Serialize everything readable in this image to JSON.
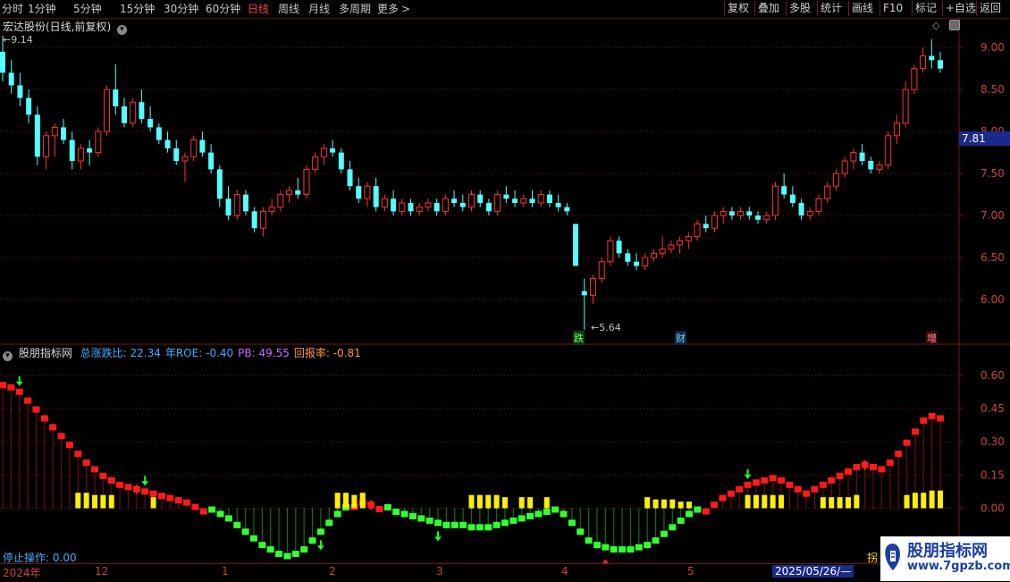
{
  "toolbar": {
    "periods": [
      "分时",
      "1分钟",
      "5分钟",
      "15分钟",
      "30分钟",
      "60分钟",
      "日线",
      "周线",
      "月线",
      "多周期",
      "更多"
    ],
    "active_period": "日线",
    "more_arrow": ">",
    "buttons": [
      "复权",
      "叠加",
      "多股",
      "统计",
      "画线",
      "F10",
      "+自选",
      "返回"
    ],
    "buttons_highlight": "标记"
  },
  "main_panel": {
    "title": "宏达股份(日线,前复权)",
    "high_label": "9.14",
    "low_label": "5.64",
    "current_price_tag": "7.81",
    "price_axis": [
      "9.00",
      "8.50",
      "8.00",
      "7.50",
      "7.00",
      "6.50",
      "6.00"
    ],
    "markers": [
      "跌",
      "财",
      "增"
    ]
  },
  "indicator_panel": {
    "name": "股朋指标网",
    "stats": [
      {
        "label": "总涨跌比:",
        "value": "22.34",
        "color": "#3ab0ff"
      },
      {
        "label": "年ROE:",
        "value": "-0.40",
        "color": "#3ab0ff"
      },
      {
        "label": "PB:",
        "value": "49.55",
        "color": "#c070ff"
      },
      {
        "label": "回报率:",
        "value": "-0.81",
        "color": "#ff9a30"
      }
    ],
    "axis": [
      "0.60",
      "0.45",
      "0.30",
      "0.15",
      "0.00"
    ],
    "stop_label": "停止操作:",
    "stop_value": "0.00"
  },
  "date_bar": {
    "labels": [
      "2024年",
      "12",
      "1",
      "2",
      "3",
      "4",
      "5"
    ],
    "selected_date": "2025/05/26/—",
    "right_text": "拐"
  },
  "watermark": {
    "line1": "股朋指标网",
    "line2": "www.7gpzb.com"
  },
  "colors": {
    "up": "#ff3333",
    "down": "#54ffff",
    "grid": "#7a1515",
    "indicator_up": "#ff1a1a",
    "indicator_down": "#33ff33",
    "bar_yellow": "#ffee00"
  },
  "chart_data": {
    "type": "candlestick",
    "price_range": [
      5.5,
      9.3
    ],
    "candles": [
      {
        "o": 8.95,
        "h": 9.14,
        "l": 8.6,
        "c": 8.7
      },
      {
        "o": 8.7,
        "h": 8.85,
        "l": 8.45,
        "c": 8.55
      },
      {
        "o": 8.55,
        "h": 8.7,
        "l": 8.3,
        "c": 8.4
      },
      {
        "o": 8.4,
        "h": 8.5,
        "l": 8.1,
        "c": 8.2
      },
      {
        "o": 8.2,
        "h": 8.3,
        "l": 7.6,
        "c": 7.7
      },
      {
        "o": 7.7,
        "h": 8.0,
        "l": 7.55,
        "c": 7.95
      },
      {
        "o": 7.95,
        "h": 8.1,
        "l": 7.7,
        "c": 8.05
      },
      {
        "o": 8.05,
        "h": 8.15,
        "l": 7.85,
        "c": 7.9
      },
      {
        "o": 7.9,
        "h": 8.0,
        "l": 7.55,
        "c": 7.65
      },
      {
        "o": 7.65,
        "h": 7.85,
        "l": 7.55,
        "c": 7.8
      },
      {
        "o": 7.8,
        "h": 7.9,
        "l": 7.6,
        "c": 7.75
      },
      {
        "o": 7.75,
        "h": 8.05,
        "l": 7.7,
        "c": 8.0
      },
      {
        "o": 8.0,
        "h": 8.55,
        "l": 7.95,
        "c": 8.5
      },
      {
        "o": 8.5,
        "h": 8.8,
        "l": 8.2,
        "c": 8.3
      },
      {
        "o": 8.3,
        "h": 8.4,
        "l": 8.05,
        "c": 8.1
      },
      {
        "o": 8.1,
        "h": 8.4,
        "l": 8.05,
        "c": 8.35
      },
      {
        "o": 8.35,
        "h": 8.5,
        "l": 8.1,
        "c": 8.15
      },
      {
        "o": 8.15,
        "h": 8.3,
        "l": 8.0,
        "c": 8.05
      },
      {
        "o": 8.05,
        "h": 8.1,
        "l": 7.85,
        "c": 7.9
      },
      {
        "o": 7.9,
        "h": 8.0,
        "l": 7.75,
        "c": 7.8
      },
      {
        "o": 7.8,
        "h": 7.9,
        "l": 7.6,
        "c": 7.65
      },
      {
        "o": 7.65,
        "h": 7.75,
        "l": 7.4,
        "c": 7.7
      },
      {
        "o": 7.7,
        "h": 7.95,
        "l": 7.65,
        "c": 7.9
      },
      {
        "o": 7.9,
        "h": 8.0,
        "l": 7.7,
        "c": 7.75
      },
      {
        "o": 7.75,
        "h": 7.85,
        "l": 7.5,
        "c": 7.55
      },
      {
        "o": 7.55,
        "h": 7.6,
        "l": 7.1,
        "c": 7.2
      },
      {
        "o": 7.2,
        "h": 7.35,
        "l": 6.95,
        "c": 7.0
      },
      {
        "o": 7.0,
        "h": 7.3,
        "l": 6.95,
        "c": 7.25
      },
      {
        "o": 7.25,
        "h": 7.3,
        "l": 7.0,
        "c": 7.05
      },
      {
        "o": 7.05,
        "h": 7.1,
        "l": 6.8,
        "c": 6.85
      },
      {
        "o": 6.85,
        "h": 7.1,
        "l": 6.75,
        "c": 7.05
      },
      {
        "o": 7.05,
        "h": 7.2,
        "l": 7.0,
        "c": 7.1
      },
      {
        "o": 7.1,
        "h": 7.3,
        "l": 7.05,
        "c": 7.25
      },
      {
        "o": 7.25,
        "h": 7.35,
        "l": 7.15,
        "c": 7.3
      },
      {
        "o": 7.3,
        "h": 7.45,
        "l": 7.2,
        "c": 7.25
      },
      {
        "o": 7.25,
        "h": 7.6,
        "l": 7.2,
        "c": 7.55
      },
      {
        "o": 7.55,
        "h": 7.75,
        "l": 7.5,
        "c": 7.7
      },
      {
        "o": 7.7,
        "h": 7.85,
        "l": 7.6,
        "c": 7.8
      },
      {
        "o": 7.8,
        "h": 7.9,
        "l": 7.7,
        "c": 7.75
      },
      {
        "o": 7.75,
        "h": 7.8,
        "l": 7.5,
        "c": 7.55
      },
      {
        "o": 7.55,
        "h": 7.65,
        "l": 7.3,
        "c": 7.35
      },
      {
        "o": 7.35,
        "h": 7.45,
        "l": 7.15,
        "c": 7.2
      },
      {
        "o": 7.2,
        "h": 7.4,
        "l": 7.1,
        "c": 7.35
      },
      {
        "o": 7.35,
        "h": 7.45,
        "l": 7.05,
        "c": 7.1
      },
      {
        "o": 7.1,
        "h": 7.25,
        "l": 7.05,
        "c": 7.2
      },
      {
        "o": 7.2,
        "h": 7.3,
        "l": 7.0,
        "c": 7.05
      },
      {
        "o": 7.05,
        "h": 7.2,
        "l": 7.0,
        "c": 7.15
      },
      {
        "o": 7.15,
        "h": 7.2,
        "l": 7.0,
        "c": 7.05
      },
      {
        "o": 7.05,
        "h": 7.15,
        "l": 7.0,
        "c": 7.1
      },
      {
        "o": 7.1,
        "h": 7.2,
        "l": 7.05,
        "c": 7.15
      },
      {
        "o": 7.15,
        "h": 7.2,
        "l": 7.0,
        "c": 7.05
      },
      {
        "o": 7.05,
        "h": 7.25,
        "l": 7.0,
        "c": 7.2
      },
      {
        "o": 7.2,
        "h": 7.3,
        "l": 7.1,
        "c": 7.15
      },
      {
        "o": 7.15,
        "h": 7.25,
        "l": 7.05,
        "c": 7.1
      },
      {
        "o": 7.1,
        "h": 7.3,
        "l": 7.05,
        "c": 7.25
      },
      {
        "o": 7.25,
        "h": 7.3,
        "l": 7.1,
        "c": 7.15
      },
      {
        "o": 7.15,
        "h": 7.2,
        "l": 7.0,
        "c": 7.05
      },
      {
        "o": 7.05,
        "h": 7.3,
        "l": 7.0,
        "c": 7.25
      },
      {
        "o": 7.25,
        "h": 7.35,
        "l": 7.15,
        "c": 7.2
      },
      {
        "o": 7.2,
        "h": 7.3,
        "l": 7.1,
        "c": 7.15
      },
      {
        "o": 7.15,
        "h": 7.25,
        "l": 7.1,
        "c": 7.2
      },
      {
        "o": 7.2,
        "h": 7.3,
        "l": 7.1,
        "c": 7.15
      },
      {
        "o": 7.15,
        "h": 7.3,
        "l": 7.1,
        "c": 7.25
      },
      {
        "o": 7.25,
        "h": 7.3,
        "l": 7.1,
        "c": 7.15
      },
      {
        "o": 7.15,
        "h": 7.25,
        "l": 7.05,
        "c": 7.1
      },
      {
        "o": 7.1,
        "h": 7.15,
        "l": 7.0,
        "c": 7.05
      },
      {
        "o": 6.9,
        "h": 6.9,
        "l": 6.4,
        "c": 6.4
      },
      {
        "o": 6.1,
        "h": 6.25,
        "l": 5.64,
        "c": 6.05
      },
      {
        "o": 6.05,
        "h": 6.3,
        "l": 5.95,
        "c": 6.25
      },
      {
        "o": 6.25,
        "h": 6.5,
        "l": 6.2,
        "c": 6.45
      },
      {
        "o": 6.45,
        "h": 6.75,
        "l": 6.4,
        "c": 6.7
      },
      {
        "o": 6.7,
        "h": 6.75,
        "l": 6.5,
        "c": 6.55
      },
      {
        "o": 6.55,
        "h": 6.6,
        "l": 6.4,
        "c": 6.45
      },
      {
        "o": 6.45,
        "h": 6.55,
        "l": 6.35,
        "c": 6.4
      },
      {
        "o": 6.4,
        "h": 6.55,
        "l": 6.35,
        "c": 6.5
      },
      {
        "o": 6.5,
        "h": 6.6,
        "l": 6.45,
        "c": 6.55
      },
      {
        "o": 6.55,
        "h": 6.75,
        "l": 6.5,
        "c": 6.6
      },
      {
        "o": 6.6,
        "h": 6.7,
        "l": 6.55,
        "c": 6.65
      },
      {
        "o": 6.65,
        "h": 6.75,
        "l": 6.55,
        "c": 6.7
      },
      {
        "o": 6.7,
        "h": 6.8,
        "l": 6.6,
        "c": 6.75
      },
      {
        "o": 6.75,
        "h": 6.95,
        "l": 6.7,
        "c": 6.9
      },
      {
        "o": 6.9,
        "h": 7.0,
        "l": 6.8,
        "c": 6.85
      },
      {
        "o": 6.85,
        "h": 7.05,
        "l": 6.8,
        "c": 7.0
      },
      {
        "o": 7.0,
        "h": 7.1,
        "l": 6.9,
        "c": 7.05
      },
      {
        "o": 7.05,
        "h": 7.1,
        "l": 6.95,
        "c": 7.0
      },
      {
        "o": 7.0,
        "h": 7.1,
        "l": 6.95,
        "c": 7.05
      },
      {
        "o": 7.05,
        "h": 7.1,
        "l": 6.95,
        "c": 7.0
      },
      {
        "o": 7.0,
        "h": 7.05,
        "l": 6.9,
        "c": 6.95
      },
      {
        "o": 6.95,
        "h": 7.05,
        "l": 6.9,
        "c": 7.0
      },
      {
        "o": 7.0,
        "h": 7.4,
        "l": 6.95,
        "c": 7.35
      },
      {
        "o": 7.35,
        "h": 7.5,
        "l": 7.2,
        "c": 7.25
      },
      {
        "o": 7.25,
        "h": 7.35,
        "l": 7.1,
        "c": 7.15
      },
      {
        "o": 7.15,
        "h": 7.2,
        "l": 6.95,
        "c": 7.0
      },
      {
        "o": 7.0,
        "h": 7.1,
        "l": 6.95,
        "c": 7.05
      },
      {
        "o": 7.05,
        "h": 7.25,
        "l": 7.0,
        "c": 7.2
      },
      {
        "o": 7.2,
        "h": 7.4,
        "l": 7.15,
        "c": 7.35
      },
      {
        "o": 7.35,
        "h": 7.55,
        "l": 7.3,
        "c": 7.5
      },
      {
        "o": 7.5,
        "h": 7.7,
        "l": 7.45,
        "c": 7.65
      },
      {
        "o": 7.65,
        "h": 7.8,
        "l": 7.55,
        "c": 7.75
      },
      {
        "o": 7.75,
        "h": 7.85,
        "l": 7.6,
        "c": 7.65
      },
      {
        "o": 7.65,
        "h": 7.7,
        "l": 7.5,
        "c": 7.55
      },
      {
        "o": 7.55,
        "h": 7.65,
        "l": 7.5,
        "c": 7.6
      },
      {
        "o": 7.6,
        "h": 8.0,
        "l": 7.55,
        "c": 7.95
      },
      {
        "o": 7.95,
        "h": 8.2,
        "l": 7.85,
        "c": 8.1
      },
      {
        "o": 8.1,
        "h": 8.6,
        "l": 8.05,
        "c": 8.5
      },
      {
        "o": 8.5,
        "h": 8.8,
        "l": 8.45,
        "c": 8.75
      },
      {
        "o": 8.75,
        "h": 9.0,
        "l": 8.7,
        "c": 8.9
      },
      {
        "o": 8.9,
        "h": 9.1,
        "l": 8.75,
        "c": 8.85
      },
      {
        "o": 8.85,
        "h": 8.95,
        "l": 8.7,
        "c": 8.75
      }
    ],
    "indicator_range": [
      -0.24,
      0.68
    ],
    "indicator": [
      0.57,
      0.56,
      0.54,
      0.5,
      0.46,
      0.42,
      0.38,
      0.34,
      0.3,
      0.26,
      0.22,
      0.19,
      0.16,
      0.14,
      0.12,
      0.11,
      0.1,
      0.09,
      0.08,
      0.07,
      0.06,
      0.05,
      0.04,
      0.02,
      0.0,
      -0.02,
      -0.04,
      -0.06,
      -0.09,
      -0.12,
      -0.15,
      -0.18,
      -0.2,
      -0.22,
      -0.23,
      -0.22,
      -0.2,
      -0.16,
      -0.12,
      -0.08,
      -0.04,
      -0.01,
      0.02,
      0.04,
      0.03,
      0.01,
      -0.01,
      -0.03,
      -0.04,
      -0.05,
      -0.06,
      -0.07,
      -0.08,
      -0.09,
      -0.09,
      -0.09,
      -0.1,
      -0.1,
      -0.1,
      -0.09,
      -0.08,
      -0.07,
      -0.06,
      -0.05,
      -0.04,
      -0.03,
      -0.02,
      -0.04,
      -0.08,
      -0.12,
      -0.16,
      -0.18,
      -0.19,
      -0.2,
      -0.2,
      -0.2,
      -0.19,
      -0.18,
      -0.16,
      -0.13,
      -0.1,
      -0.07,
      -0.04,
      -0.02,
      0.0,
      0.03,
      0.06,
      0.08,
      0.1,
      0.12,
      0.13,
      0.14,
      0.15,
      0.14,
      0.12,
      0.1,
      0.08,
      0.1,
      0.12,
      0.14,
      0.16,
      0.18,
      0.2,
      0.21,
      0.2,
      0.19,
      0.22,
      0.26,
      0.31,
      0.36,
      0.41,
      0.43,
      0.42
    ],
    "indicator_volume": [
      0.0,
      0.0,
      0.0,
      0.0,
      0.0,
      0.0,
      0.0,
      0.0,
      0.0,
      0.07,
      0.07,
      0.06,
      0.06,
      0.06,
      0.0,
      0.0,
      0.0,
      0.0,
      0.05,
      0.0,
      0.0,
      0.0,
      0.0,
      0.0,
      0.0,
      0.0,
      0.0,
      0.0,
      0.0,
      0.0,
      0.0,
      0.0,
      0.0,
      0.0,
      0.0,
      0.0,
      0.0,
      0.0,
      0.0,
      0.0,
      0.07,
      0.07,
      0.06,
      0.07,
      0.0,
      0.0,
      0.0,
      0.0,
      0.0,
      0.0,
      0.0,
      0.0,
      0.0,
      0.0,
      0.0,
      0.0,
      0.06,
      0.06,
      0.06,
      0.06,
      0.05,
      0.0,
      0.05,
      0.05,
      0.0,
      0.05,
      0.0,
      0.0,
      0.0,
      0.0,
      0.0,
      0.0,
      0.0,
      0.0,
      0.0,
      0.0,
      0.0,
      0.05,
      0.04,
      0.04,
      0.04,
      0.03,
      0.03,
      0.0,
      0.0,
      0.0,
      0.0,
      0.0,
      0.0,
      0.06,
      0.06,
      0.06,
      0.06,
      0.06,
      0.0,
      0.0,
      0.0,
      0.0,
      0.05,
      0.05,
      0.05,
      0.05,
      0.06,
      0.0,
      0.0,
      0.0,
      0.0,
      0.0,
      0.06,
      0.07,
      0.07,
      0.08,
      0.08
    ],
    "signals_up": [
      16,
      44,
      72,
      103
    ],
    "signals_down": [
      2,
      17,
      38,
      52,
      89
    ]
  }
}
